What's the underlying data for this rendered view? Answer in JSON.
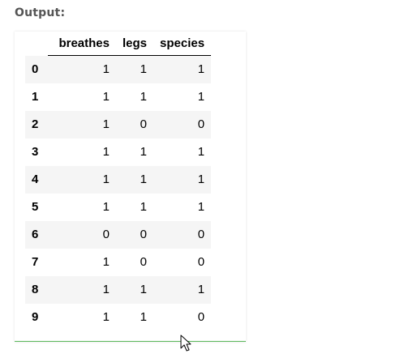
{
  "output_label": "Output:",
  "table": {
    "columns": [
      "breathes",
      "legs",
      "species"
    ],
    "rows": [
      {
        "index": "0",
        "values": [
          "1",
          "1",
          "1"
        ]
      },
      {
        "index": "1",
        "values": [
          "1",
          "1",
          "1"
        ]
      },
      {
        "index": "2",
        "values": [
          "1",
          "0",
          "0"
        ]
      },
      {
        "index": "3",
        "values": [
          "1",
          "1",
          "1"
        ]
      },
      {
        "index": "4",
        "values": [
          "1",
          "1",
          "1"
        ]
      },
      {
        "index": "5",
        "values": [
          "1",
          "1",
          "1"
        ]
      },
      {
        "index": "6",
        "values": [
          "0",
          "0",
          "0"
        ]
      },
      {
        "index": "7",
        "values": [
          "1",
          "0",
          "0"
        ]
      },
      {
        "index": "8",
        "values": [
          "1",
          "1",
          "1"
        ]
      },
      {
        "index": "9",
        "values": [
          "1",
          "1",
          "0"
        ]
      }
    ]
  },
  "colors": {
    "label": "#555555",
    "row_stripe": "#f5f5f5",
    "panel_bottom_border": "#5cb85c"
  },
  "icons": {
    "cursor": "mouse-pointer-icon"
  }
}
